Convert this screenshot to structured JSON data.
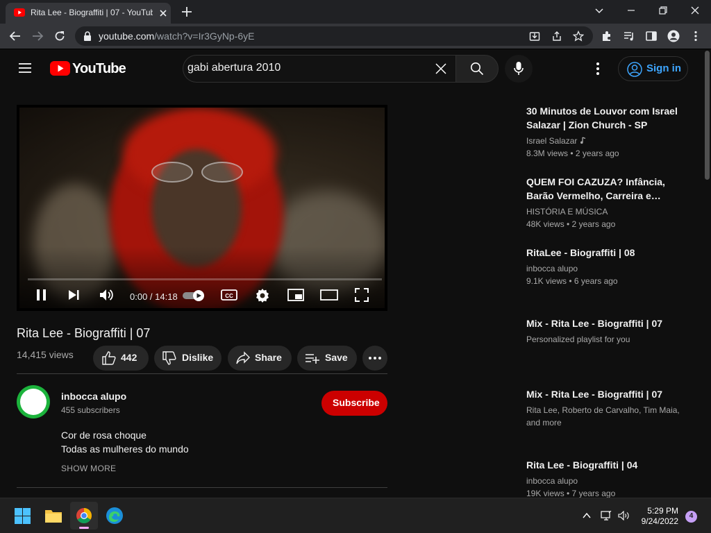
{
  "browser": {
    "tab_title": "Rita Lee - Biograffiti | 07 - YouTub",
    "url_host": "youtube.com",
    "url_path": "/watch?v=Ir3GyNp-6yE"
  },
  "youtube": {
    "logo_text": "YouTube",
    "search_query": "gabi abertura 2010",
    "signin_label": "Sign in"
  },
  "player": {
    "time": "0:00 / 14:18",
    "progress": 0
  },
  "video": {
    "title": "Rita Lee - Biograffiti | 07",
    "views": "14,415 views",
    "like_count": "442",
    "dislike_label": "Dislike",
    "share_label": "Share",
    "save_label": "Save"
  },
  "channel": {
    "name": "inbocca alupo",
    "subscribers": "455 subscribers",
    "subscribe_label": "Subscribe",
    "description": [
      "Cor de rosa choque",
      "Todas as mulheres do mundo"
    ],
    "show_more": "SHOW MORE"
  },
  "related": [
    {
      "title": "30 Minutos de Louvor com Israel Salazar | Zion Church - SP",
      "channel": "Israel Salazar",
      "meta": "8.3M views • 2 years ago",
      "music_note": true
    },
    {
      "title": "QUEM FOI CAZUZA? Infância, Barão Vermelho, Carreira e…",
      "channel": "HISTÓRIA E MÚSICA",
      "meta": "48K views • 2 years ago"
    },
    {
      "title": "RitaLee - Biograffiti | 08",
      "channel": "inbocca alupo",
      "meta": "9.1K views • 6 years ago"
    },
    {
      "title": "Mix - Rita Lee - Biograffiti | 07",
      "channel": "Personalized playlist for you",
      "meta": ""
    },
    {
      "title": "Mix - Rita Lee - Biograffiti | 07",
      "channel": "Rita Lee, Roberto de Carvalho, Tim Maia, and more",
      "meta": ""
    },
    {
      "title": "Rita Lee - Biograffiti | 04",
      "channel": "inbocca alupo",
      "meta": "19K views • 7 years ago"
    }
  ],
  "taskbar": {
    "time": "5:29 PM",
    "date": "9/24/2022",
    "notification_count": "4"
  },
  "colors": {
    "yt_red": "#ff0000",
    "subscribe_red": "#cc0000",
    "link_blue": "#3ea6ff",
    "background": "#0f0f0f"
  },
  "icons": [
    "youtube-favicon",
    "menu-icon",
    "search-icon",
    "mic-icon",
    "more-vert-icon",
    "account-icon",
    "pause-icon",
    "next-icon",
    "volume-icon",
    "autoplay-toggle",
    "cc-icon",
    "settings-icon",
    "miniplayer-icon",
    "theater-icon",
    "fullscreen-icon",
    "thumbs-up-icon",
    "thumbs-down-icon",
    "share-icon",
    "playlist-add-icon",
    "windows-start-icon",
    "file-explorer-icon",
    "chrome-icon",
    "edge-icon"
  ]
}
